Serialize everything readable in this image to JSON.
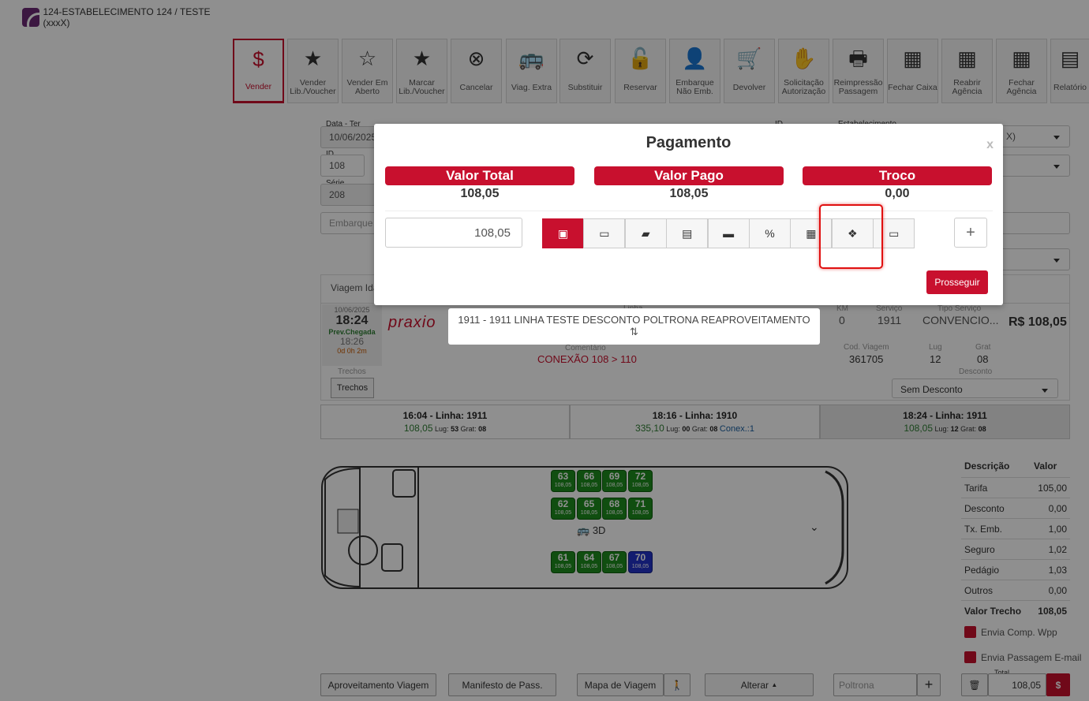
{
  "header": {
    "establishment": "124-ESTABELECIMENTO 124 / TESTE (xxxX)"
  },
  "toolbar": [
    {
      "label": "Vender",
      "icon": "dollar-icon",
      "glyph": "$"
    },
    {
      "label": "Vender Lib./Voucher",
      "icon": "star-half-icon",
      "glyph": "★"
    },
    {
      "label": "Vender Em Aberto",
      "icon": "star-outline-icon",
      "glyph": "☆"
    },
    {
      "label": "Marcar Lib./Voucher",
      "icon": "star-icon",
      "glyph": "★"
    },
    {
      "label": "Cancelar",
      "icon": "cancel-circle-icon",
      "glyph": "⊗"
    },
    {
      "label": "Viag. Extra",
      "icon": "bus-icon",
      "glyph": "🚌"
    },
    {
      "label": "Substituir",
      "icon": "refresh-icon",
      "glyph": "⟳"
    },
    {
      "label": "Reservar",
      "icon": "lock-icon",
      "glyph": "🔓"
    },
    {
      "label": "Embarque Não Emb.",
      "icon": "user-plus-icon",
      "glyph": "👤"
    },
    {
      "label": "Devolver",
      "icon": "cart-icon",
      "glyph": "🛒"
    },
    {
      "label": "Solicitação Autorização",
      "icon": "hand-icon",
      "glyph": "✋"
    },
    {
      "label": "Reimpressão Passagem",
      "icon": "printer-icon",
      "glyph": "🖶"
    },
    {
      "label": "Fechar Caixa",
      "icon": "cash-register-icon",
      "glyph": "▦"
    },
    {
      "label": "Reabrir Agência",
      "icon": "cash-register-icon",
      "glyph": "▦"
    },
    {
      "label": "Fechar Agência",
      "icon": "cash-register-icon",
      "glyph": "▦"
    },
    {
      "label": "Relatório",
      "icon": "document-icon",
      "glyph": "▤"
    }
  ],
  "form": {
    "data_label": "Data - Ter",
    "data_value": "10/06/2025",
    "id_label": "ID",
    "id_value": "108",
    "serie_label": "Série",
    "serie_value": "208",
    "id2_label": "ID",
    "estab_label": "Estabelecimento",
    "estab_suffix": "X)",
    "embarque_placeholder": "Embarque"
  },
  "trip": {
    "tab": "Viagem Ida",
    "date": "10/06/2025",
    "time": "18:24",
    "prev_label": "Prev.Chegada",
    "arrival": "18:26",
    "duration": "0d 0h 2m",
    "brand": "praxio",
    "linha_label": "Linha",
    "linha": "1911 - 1911 LINHA TESTE DESCONTO POLTRONA REAPROVEITAMENTO",
    "comentario_label": "Comentário",
    "comentario": "CONEXÃO 108 > 110",
    "km_label": "KM",
    "km": "0",
    "servico_label": "Serviço",
    "servico": "1911",
    "tipo_label": "Tipo Serviço",
    "tipo": "CONVENCIO...",
    "price": "R$ 108,05",
    "cod_label": "Cod. Viagem",
    "cod": "361705",
    "lug_label": "Lug",
    "lug": "12",
    "grat_label": "Grat",
    "grat": "08",
    "trechos_label": "Trechos",
    "trechos_btn": "Trechos",
    "desconto_label": "Desconto",
    "desconto": "Sem Desconto"
  },
  "segments": [
    {
      "title": "16:04 - Linha: 1911",
      "value": "108,05",
      "lug": "53",
      "grat": "08",
      "conex": ""
    },
    {
      "title": "18:16 - Linha: 1910",
      "value": "335,10",
      "lug": "00",
      "grat": "08",
      "conex": "Conex.:1"
    },
    {
      "title": "18:24 - Linha: 1911",
      "value": "108,05",
      "lug": "12",
      "grat": "08",
      "conex": ""
    }
  ],
  "seg_labels": {
    "lug": "Lug:",
    "grat": "Grat:"
  },
  "seats": [
    {
      "n": "63",
      "p": "108,05",
      "state": "free"
    },
    {
      "n": "66",
      "p": "108,05",
      "state": "free"
    },
    {
      "n": "69",
      "p": "108,05",
      "state": "free"
    },
    {
      "n": "72",
      "p": "108,05",
      "state": "free"
    },
    {
      "n": "62",
      "p": "108,05",
      "state": "free"
    },
    {
      "n": "65",
      "p": "108,05",
      "state": "free"
    },
    {
      "n": "68",
      "p": "108,05",
      "state": "free"
    },
    {
      "n": "71",
      "p": "108,05",
      "state": "free"
    },
    {
      "n": "61",
      "p": "108,05",
      "state": "free"
    },
    {
      "n": "64",
      "p": "108,05",
      "state": "free"
    },
    {
      "n": "67",
      "p": "108,05",
      "state": "free"
    },
    {
      "n": "70",
      "p": "108,05",
      "state": "selected"
    }
  ],
  "bus_3d": "3D",
  "summary": {
    "h1": "Descrição",
    "h2": "Valor",
    "rows": [
      {
        "k": "Tarifa",
        "v": "105,00"
      },
      {
        "k": "Desconto",
        "v": "0,00"
      },
      {
        "k": "Tx. Emb.",
        "v": "1,00"
      },
      {
        "k": "Seguro",
        "v": "1,02"
      },
      {
        "k": "Pedágio",
        "v": "1,03"
      },
      {
        "k": "Outros",
        "v": "0,00"
      },
      {
        "k": "Valor Trecho",
        "v": "108,05"
      }
    ],
    "wpp": "Envia Comp. Wpp",
    "email": "Envia Passagem E-mail",
    "total_label": "Total",
    "total": "108,05"
  },
  "bottom": {
    "aproveitamento": "Aproveitamento Viagem",
    "manifesto": "Manifesto de Pass.",
    "mapa": "Mapa de Viagem",
    "alterar": "Alterar",
    "poltrona_placeholder": "Poltrona"
  },
  "modal": {
    "title": "Pagamento",
    "close": "x",
    "total_label": "Valor Total",
    "total": "108,05",
    "pago_label": "Valor Pago",
    "pago": "108,05",
    "troco_label": "Troco",
    "troco": "0,00",
    "amount": "108,05",
    "methods": [
      "money-icon",
      "credit-card-icon",
      "ticket-icon",
      "bill-icon",
      "voucher-icon",
      "discount-ticket-icon",
      "qrcode-icon",
      "pix-icon",
      "id-card-icon"
    ],
    "add": "+",
    "proceed": "Prosseguir"
  },
  "colors": {
    "accent": "#c8102e",
    "seat_free": "#1d8c1d",
    "seat_selected": "#2233c8",
    "highlight": "#e01010"
  }
}
